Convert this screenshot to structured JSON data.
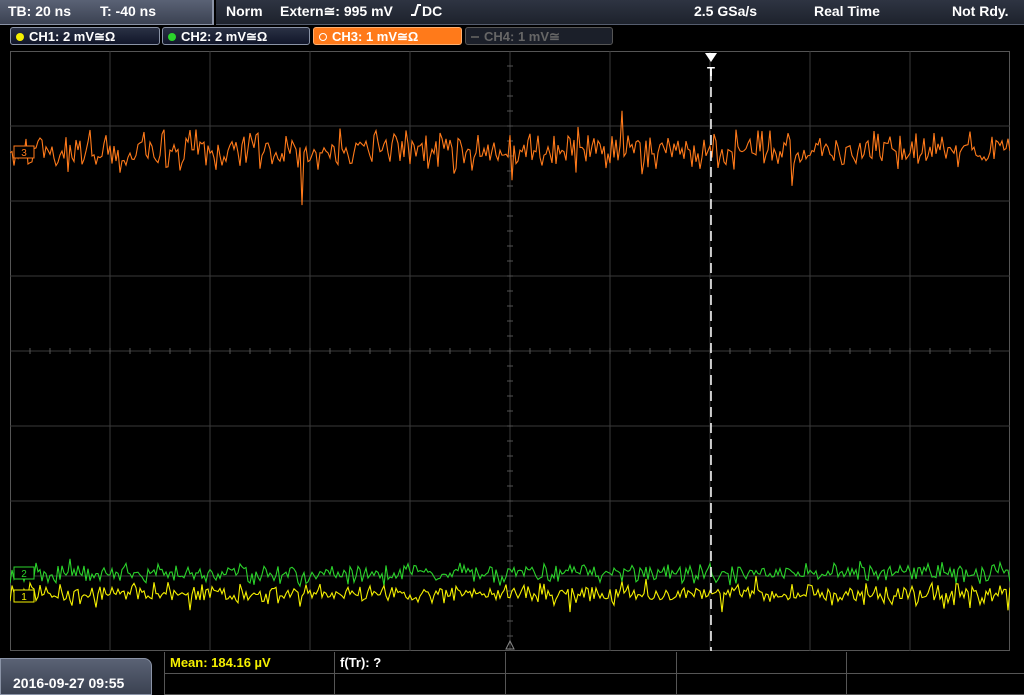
{
  "topbar": {
    "timebase": "TB: 20 ns",
    "trigger_time": "T: -40 ns",
    "mode": "Norm",
    "trigger_source": "Extern≅: 995 mV",
    "trigger_slope": "DC",
    "sample_rate": "2.5 GSa/s",
    "acq_mode": "Real Time",
    "status": "Not Rdy."
  },
  "channels": [
    {
      "label": "CH1: 2 mV≅Ω",
      "color": "#f5f000",
      "state": "on"
    },
    {
      "label": "CH2: 2 mV≅Ω",
      "color": "#2bd32b",
      "state": "on"
    },
    {
      "label": "CH3: 1 mV≅Ω",
      "color": "#ff7a1a",
      "state": "selected"
    },
    {
      "label": "CH4: 1 mV≅",
      "color": "#666666",
      "state": "off"
    }
  ],
  "markers": {
    "trigger": "T",
    "ch3": "3",
    "ch2": "2",
    "ch1": "1"
  },
  "colors": {
    "grid": "#3a3a3a",
    "ch3_trace": "#ff7a1a",
    "ch2_trace": "#2bd32b",
    "ch1_trace": "#f5f000"
  },
  "measurements": {
    "mean": "Mean: 184.16 µV",
    "freq": "f(Tr): ?"
  },
  "datetime": "2016-09-27 09:55"
}
